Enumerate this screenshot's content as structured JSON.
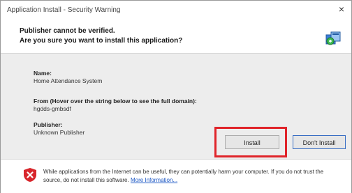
{
  "window": {
    "title": "Application Install - Security Warning",
    "close_glyph": "×"
  },
  "header": {
    "line1": "Publisher cannot be verified.",
    "line2": "Are you sure you want to install this application?",
    "icon": "application-install-icon"
  },
  "details": {
    "name_label": "Name:",
    "name_value": "Home Attendance System",
    "from_label": "From (Hover over the string below to see the full domain):",
    "from_value": "hgdds-gmbsdf",
    "publisher_label": "Publisher:",
    "publisher_value": "Unknown Publisher"
  },
  "buttons": {
    "install": "Install",
    "dont_install": "Don't Install"
  },
  "footer": {
    "icon": "shield-warning-icon",
    "text": "While applications from the Internet can be useful, they can potentially harm your computer. If you do not trust the source, do not install this software.",
    "link": "More Information..."
  },
  "colors": {
    "highlight": "#e0242a",
    "link": "#1a56c4",
    "warning": "#d8262c"
  }
}
